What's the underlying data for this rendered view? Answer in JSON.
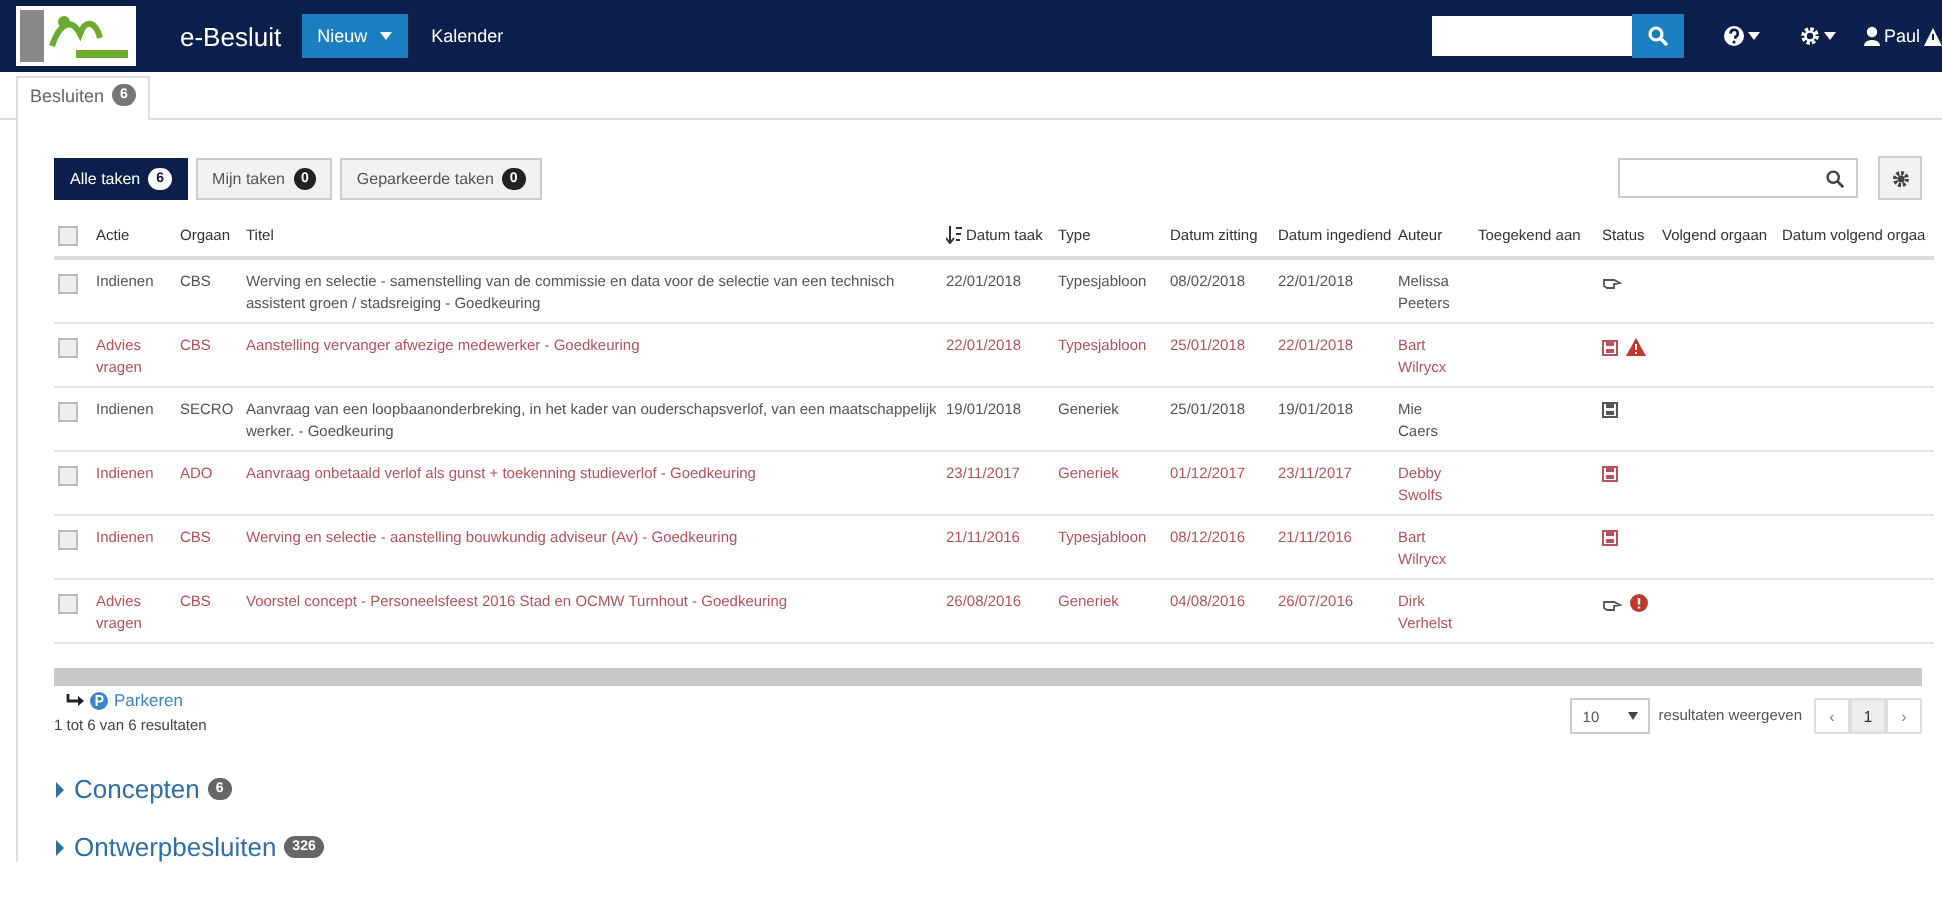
{
  "navbar": {
    "brand": "e-Besluit",
    "new_button": "Nieuw",
    "link": "Kalender",
    "user": "Paul"
  },
  "tab": {
    "label": "Besluiten",
    "count": "6",
    "selected": true
  },
  "filters": [
    {
      "label": "Alle taken",
      "count": "6",
      "selected": true
    },
    {
      "label": "Mijn taken",
      "count": "0",
      "selected": false
    },
    {
      "label": "Geparkeerde taken",
      "count": "0",
      "selected": false
    }
  ],
  "table": {
    "columns": [
      {
        "label": "Actie",
        "sorted": false
      },
      {
        "label": "Orgaan",
        "sorted": false
      },
      {
        "label": "Titel",
        "sorted": false
      },
      {
        "label": "Datum taak",
        "sorted": true
      },
      {
        "label": "Type",
        "sorted": false
      },
      {
        "label": "Datum zitting",
        "sorted": false
      },
      {
        "label": "Datum ingediend",
        "sorted": false
      },
      {
        "label": "Auteur",
        "sorted": false
      },
      {
        "label": "Toegekend aan",
        "sorted": false
      },
      {
        "label": "Status",
        "sorted": false
      },
      {
        "label": "Volgend orgaan",
        "sorted": false
      },
      {
        "label": "Datum volgend orgaa",
        "sorted": false
      }
    ],
    "select_all": {
      "checked": false
    },
    "rows": [
      {
        "checked": false,
        "highlighted": false,
        "actie": "Indienen",
        "orgaan": "CBS",
        "titel": "Werving en selectie - samenstelling van de commissie en data voor de selectie van een technisch assistent groen / stadsreiging - Goedkeuring",
        "datum_taak": "22/01/2018",
        "type": "Typesjabloon",
        "datum_zitting": "08/02/2018",
        "datum_ingediend": "22/01/2018",
        "auteur": "Melissa Peeters",
        "status": [
          {
            "kind": "hand"
          }
        ]
      },
      {
        "checked": false,
        "highlighted": true,
        "actie": "Advies vragen",
        "orgaan": "CBS",
        "titel": "Aanstelling vervanger afwezige medewerker - Goedkeuring",
        "datum_taak": "22/01/2018",
        "type": "Typesjabloon",
        "datum_zitting": "25/01/2018",
        "datum_ingediend": "22/01/2018",
        "auteur": "Bart Wilrycx",
        "status": [
          {
            "kind": "save"
          },
          {
            "kind": "warning"
          }
        ]
      },
      {
        "checked": false,
        "highlighted": false,
        "actie": "Indienen",
        "orgaan": "SECRO",
        "titel": "Aanvraag van een loopbaanonderbreking, in het kader van ouderschapsverlof, van een maatschappelijk werker. - Goedkeuring",
        "datum_taak": "19/01/2018",
        "type": "Generiek",
        "datum_zitting": "25/01/2018",
        "datum_ingediend": "19/01/2018",
        "auteur": "Mie Caers",
        "status": [
          {
            "kind": "save"
          }
        ]
      },
      {
        "checked": false,
        "highlighted": true,
        "actie": "Indienen",
        "orgaan": "ADO",
        "titel": "Aanvraag onbetaald verlof als gunst + toekenning studieverlof - Goedkeuring",
        "datum_taak": "23/11/2017",
        "type": "Generiek",
        "datum_zitting": "01/12/2017",
        "datum_ingediend": "23/11/2017",
        "auteur": "Debby Swolfs",
        "status": [
          {
            "kind": "save"
          }
        ]
      },
      {
        "checked": false,
        "highlighted": true,
        "actie": "Indienen",
        "orgaan": "CBS",
        "titel": "Werving en selectie - aanstelling bouwkundig adviseur (Av) - Goedkeuring",
        "datum_taak": "21/11/2016",
        "type": "Typesjabloon",
        "datum_zitting": "08/12/2016",
        "datum_ingediend": "21/11/2016",
        "auteur": "Bart Wilrycx",
        "status": [
          {
            "kind": "save"
          }
        ]
      },
      {
        "checked": false,
        "highlighted": true,
        "actie": "Advies vragen",
        "orgaan": "CBS",
        "titel": "Voorstel concept - Personeelsfeest 2016 Stad en OCMW Turnhout - Goedkeuring",
        "datum_taak": "26/08/2016",
        "type": "Generiek",
        "datum_zitting": "04/08/2016",
        "datum_ingediend": "26/07/2016",
        "auteur": "Dirk Verhelst",
        "status": [
          {
            "kind": "hand"
          },
          {
            "kind": "alert"
          }
        ]
      }
    ]
  },
  "park_button": "Parkeren",
  "summary": "1 tot 6 van 6 resultaten",
  "page_size": "10",
  "page_size_label": "resultaten weergeven",
  "pagination": {
    "prev": "‹",
    "pages": [
      {
        "label": "1",
        "selected": true
      }
    ],
    "next": "›"
  },
  "sections": [
    {
      "label": "Concepten",
      "count": "6",
      "expanded": false
    },
    {
      "label": "Ontwerpbesluiten",
      "count": "326",
      "expanded": false
    }
  ]
}
